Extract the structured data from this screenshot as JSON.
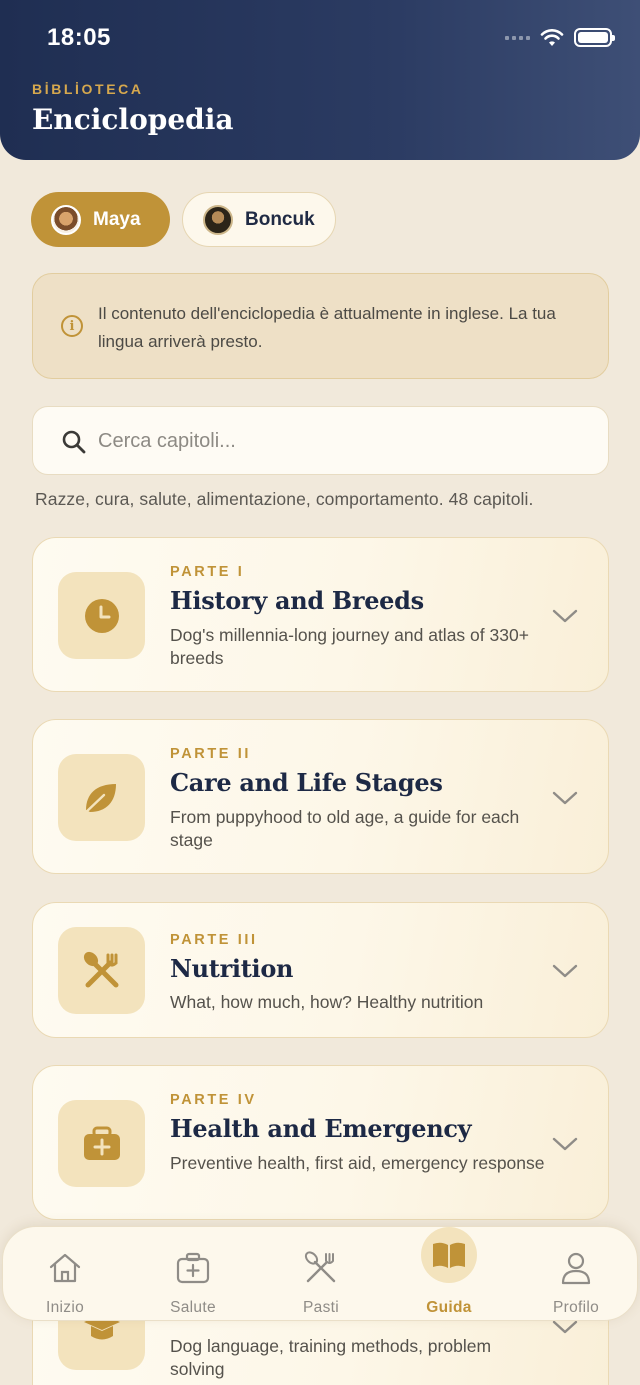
{
  "status": {
    "time": "18:05"
  },
  "header": {
    "eyebrow": "BİBLİOTECA",
    "title": "Enciclopedia"
  },
  "pets": [
    {
      "name": "Maya",
      "selected": true
    },
    {
      "name": "Boncuk",
      "selected": false
    }
  ],
  "notice": {
    "icon": "info-icon",
    "text": "Il contenuto dell'enciclopedia è attualmente in inglese. La tua lingua arriverà presto."
  },
  "search": {
    "placeholder": "Cerca capitoli...",
    "value": ""
  },
  "caption": "Razze, cura, salute, alimentazione, comportamento. 48 capitoli.",
  "parts": [
    {
      "part": "PARTE I",
      "title": "History and Breeds",
      "description": "Dog's millennia-long journey and atlas of 330+ breeds",
      "icon": "clock-icon"
    },
    {
      "part": "PARTE II",
      "title": "Care and Life Stages",
      "description": "From puppyhood to old age, a guide for each stage",
      "icon": "leaf-icon"
    },
    {
      "part": "PARTE III",
      "title": "Nutrition",
      "description": "What, how much, how? Healthy nutrition",
      "icon": "utensils-icon"
    },
    {
      "part": "PARTE IV",
      "title": "Health and Emergency",
      "description": "Preventive health, first aid, emergency response",
      "icon": "medkit-icon"
    },
    {
      "part": "",
      "title": "",
      "description": "Dog language, training methods, problem solving",
      "icon": "graduation-cap-icon"
    }
  ],
  "tabs": [
    {
      "label": "Inizio",
      "icon": "home-icon",
      "active": false
    },
    {
      "label": "Salute",
      "icon": "medical-bag-icon",
      "active": false
    },
    {
      "label": "Pasti",
      "icon": "utensils-icon",
      "active": false
    },
    {
      "label": "Guida",
      "icon": "book-icon",
      "active": true
    },
    {
      "label": "Profilo",
      "icon": "user-icon",
      "active": false
    }
  ],
  "colors": {
    "accent": "#c09338",
    "header": "#1f2e52",
    "background": "#f1e9db"
  }
}
